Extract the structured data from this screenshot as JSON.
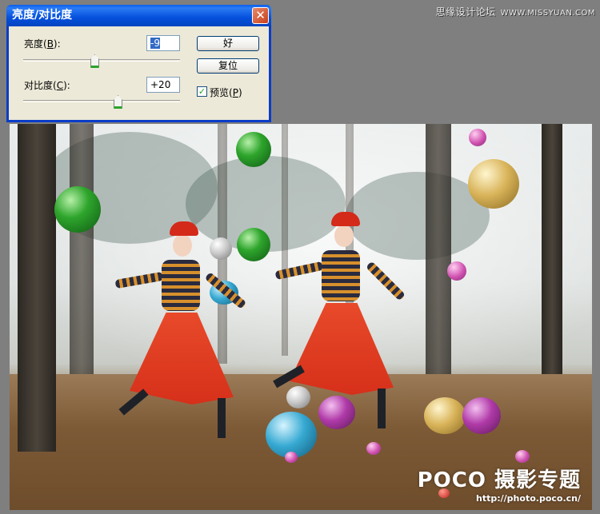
{
  "watermark_top": {
    "site": "思缘设计论坛",
    "url": "WWW.MISSYUAN.COM"
  },
  "dialog": {
    "title": "亮度/对比度",
    "close_icon": "close-icon",
    "brightness": {
      "label_pre": "亮度(",
      "key": "B",
      "label_post": "):",
      "value": "-9",
      "slider_fraction": 0.45
    },
    "contrast": {
      "label_pre": "对比度(",
      "key": "C",
      "label_post": "):",
      "value": "+20",
      "slider_fraction": 0.6
    },
    "ok_label": "好",
    "reset_label": "复位",
    "preview": {
      "label_pre": "预览(",
      "key": "P",
      "label_post": ")",
      "checked": true,
      "check": "✓"
    }
  },
  "photo_watermark": {
    "brand": "POCO 摄影专题",
    "url": "http://photo.poco.cn/"
  }
}
